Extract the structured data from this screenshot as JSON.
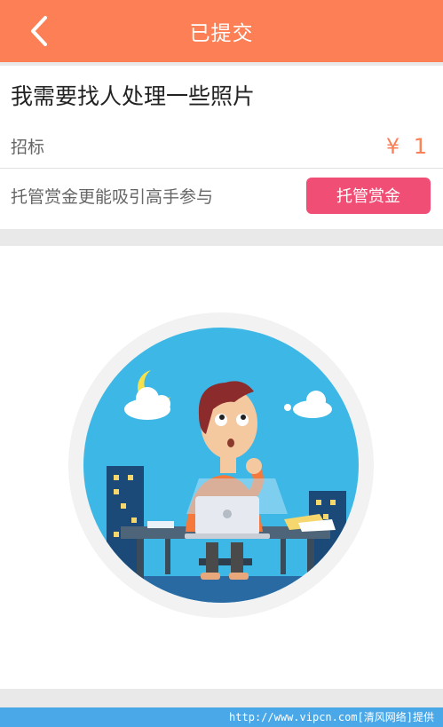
{
  "header": {
    "title": "已提交",
    "back_icon": "chevron-left-icon"
  },
  "task": {
    "title": "我需要找人处理一些照片",
    "type_label": "招标",
    "price": "¥ 1",
    "escrow_hint": "托管赏金更能吸引高手参与",
    "escrow_button": "托管赏金"
  },
  "illustration": {
    "laptop_logo_icon": "apple-icon"
  },
  "watermark": "http://www.vipcn.com[清风网络]提供",
  "colors": {
    "header": "#fc7f55",
    "accent_button": "#f14e75",
    "price": "#fc7f55",
    "footer": "#4aa8e8"
  }
}
